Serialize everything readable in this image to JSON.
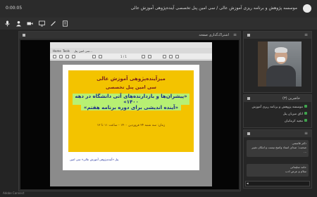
{
  "window": {
    "clock": "0:00:05",
    "title": "موسسه پژوهش و برنامه ریزی آموزش عالی / سی امین پنل تخصصی آینده‌پژوهی آموزش عالی"
  },
  "toolbar": {
    "items": [
      "mic-icon",
      "person-icon",
      "video-icon",
      "screen-share-icon",
      "pen-icon",
      "document-icon"
    ]
  },
  "share_pod": {
    "title": "اشتراک‌گذاری صفحه"
  },
  "viewer": {
    "tabs": [
      "Home",
      "Tools",
      "سی امین پنل..."
    ],
    "page_indicator": "1 / 1"
  },
  "slide": {
    "line1": "میزآینده‌پژوهی آموزش عالی",
    "line2": "سی امین پنل تخصصی",
    "line3": "«پیشران‌ها و بازدارنده‌های آتی دانشگاه در دهه ۱۴۰۰»",
    "line4": "«آینده اندیشی برای دوره برنامه هفتم»",
    "line5": "زمان: سه شنبه ۲۴ فروردین ۱۴۰۰ - ساعت ۱۱ تا ۱۲",
    "footer": "پنل «آینده‌پژوهی آموزش عالی» سی امین"
  },
  "attendees": {
    "title": "حاضرین (۳)",
    "rows": [
      "موسسه پژوهش و برنامه ریزی آموزش",
      "اتاق میزبان پنل",
      "مجید کرمانیان"
    ]
  },
  "chat": {
    "messages": [
      "دکتر قاسمی",
      "صحبت: صدای استاد واضح نیست و امکان تغییر ...",
      "حامد سلیمانی",
      "سلام و عرض ادب"
    ]
  },
  "status_bar": "Adobe Connect"
}
